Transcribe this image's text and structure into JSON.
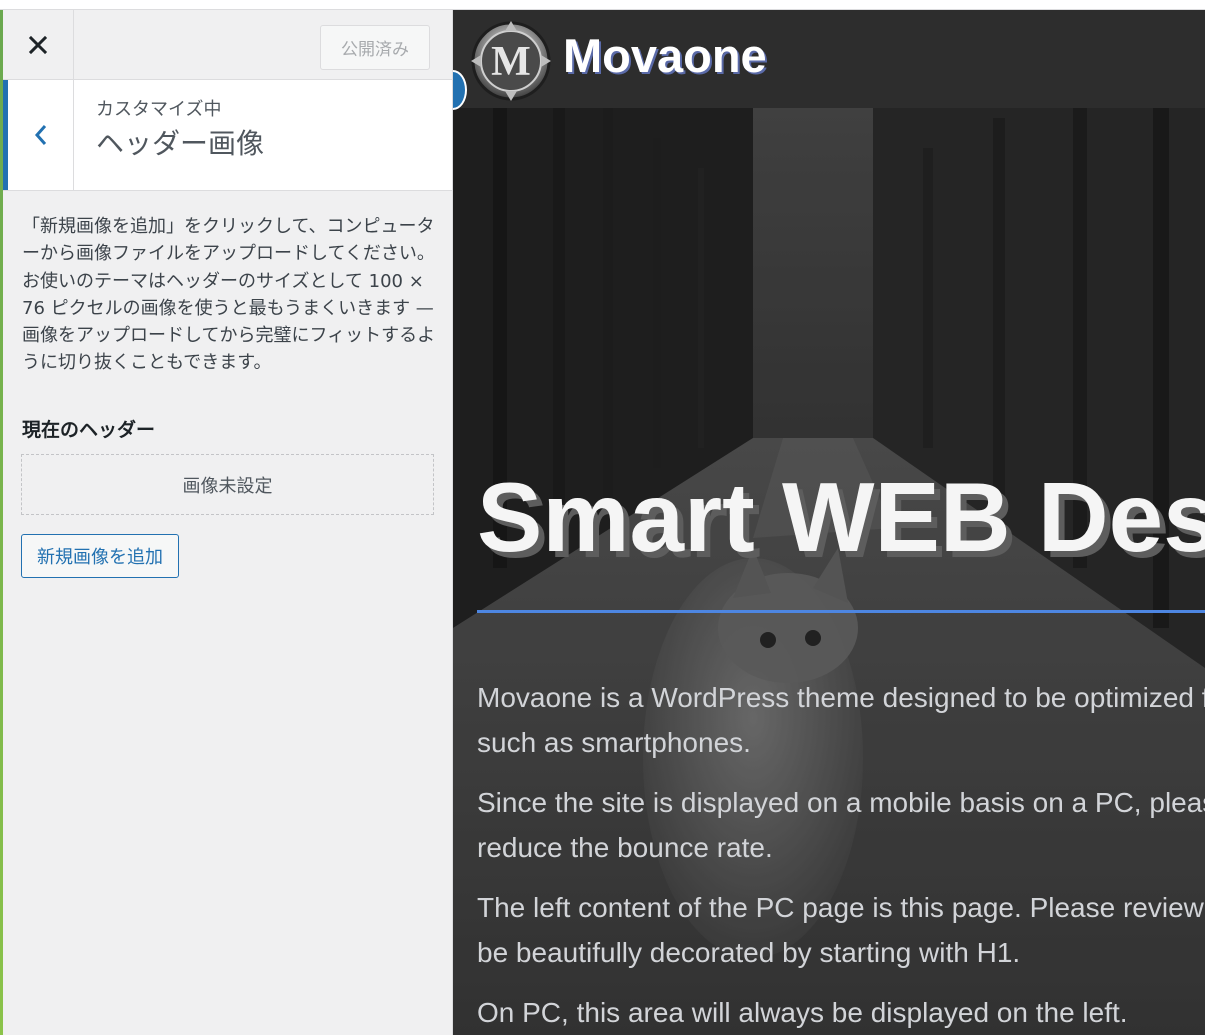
{
  "colors": {
    "accent": "#2271b1",
    "sidebar_bg": "#f0f0f1",
    "hero_rule": "#4d86e2",
    "site_header_bg": "#2d2d2d"
  },
  "customizer": {
    "close_icon": "close-icon",
    "publish_label": "公開済み",
    "back_icon": "chevron-left-icon",
    "section_context": "カスタマイズ中",
    "section_title": "ヘッダー画像",
    "description": "「新規画像を追加」をクリックして、コンピューターから画像ファイルをアップロードしてください。お使いのテーマはヘッダーのサイズとして 100 × 76 ピクセルの画像を使うと最もうまくいきます — 画像をアップロードしてから完璧にフィットするように切り抜くこともできます。",
    "current_header_label": "現在のヘッダー",
    "no_image_text": "画像未設定",
    "add_image_button": "新規画像を追加"
  },
  "preview": {
    "site_title": "Movaone",
    "logo_letter": "M",
    "hero_heading": "Smart WEB Design",
    "paragraphs": [
      "Movaone is a WordPress theme designed to be optimized for mobile devices",
      "such as smartphones.",
      "Since the site is displayed on a mobile basis on a PC, please use it to",
      "reduce the bounce rate.",
      "The left content of the PC page is this page. Please review it so it will",
      "be beautifully decorated by starting with H1.",
      "On PC, this area will always be displayed on the left."
    ]
  }
}
